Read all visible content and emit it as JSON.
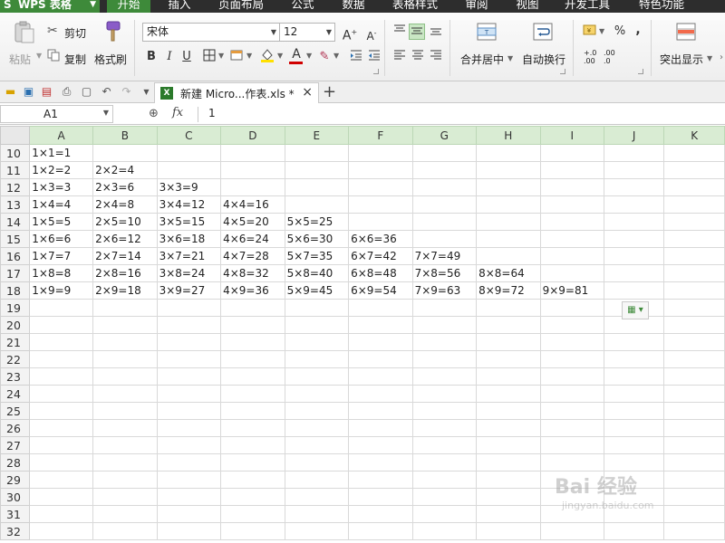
{
  "menubar": {
    "app_button": "WPS 表格",
    "tabs": [
      "开始",
      "插入",
      "页面布局",
      "公式",
      "数据",
      "表格样式",
      "审阅",
      "视图",
      "开发工具",
      "特色功能"
    ],
    "active_tab": "开始"
  },
  "ribbon": {
    "paste": "粘贴",
    "cut": "剪切",
    "copy": "复制",
    "format_painter": "格式刷",
    "font_name": "宋体",
    "font_size": "12",
    "merge_center": "合并居中",
    "wrap_text": "自动换行",
    "highlight": "突出显示",
    "percent": "%",
    "comma": ",",
    "inc_decimal": "+.0 .00",
    "dec_decimal": ".00 .0",
    "bold": "B",
    "italic": "I",
    "underline": "U",
    "font_color_label": "A",
    "grow_font": "A",
    "shrink_font": "A"
  },
  "doc_tab": {
    "icon_text": "X",
    "name": "新建 Micro...作表.xls *"
  },
  "formula_bar": {
    "name_box": "A1",
    "fx": "fx",
    "value": "1"
  },
  "columns": [
    "A",
    "B",
    "C",
    "D",
    "E",
    "F",
    "G",
    "H",
    "I",
    "J",
    "K"
  ],
  "rows": [
    {
      "num": "10",
      "cells": [
        "1×1=1",
        "",
        "",
        "",
        "",
        "",
        "",
        "",
        "",
        "",
        ""
      ]
    },
    {
      "num": "11",
      "cells": [
        "1×2=2",
        "2×2=4",
        "",
        "",
        "",
        "",
        "",
        "",
        "",
        "",
        ""
      ]
    },
    {
      "num": "12",
      "cells": [
        "1×3=3",
        "2×3=6",
        "3×3=9",
        "",
        "",
        "",
        "",
        "",
        "",
        "",
        ""
      ]
    },
    {
      "num": "13",
      "cells": [
        "1×4=4",
        "2×4=8",
        "3×4=12",
        "4×4=16",
        "",
        "",
        "",
        "",
        "",
        "",
        ""
      ]
    },
    {
      "num": "14",
      "cells": [
        "1×5=5",
        "2×5=10",
        "3×5=15",
        "4×5=20",
        "5×5=25",
        "",
        "",
        "",
        "",
        "",
        ""
      ]
    },
    {
      "num": "15",
      "cells": [
        "1×6=6",
        "2×6=12",
        "3×6=18",
        "4×6=24",
        "5×6=30",
        "6×6=36",
        "",
        "",
        "",
        "",
        ""
      ]
    },
    {
      "num": "16",
      "cells": [
        "1×7=7",
        "2×7=14",
        "3×7=21",
        "4×7=28",
        "5×7=35",
        "6×7=42",
        "7×7=49",
        "",
        "",
        "",
        ""
      ]
    },
    {
      "num": "17",
      "cells": [
        "1×8=8",
        "2×8=16",
        "3×8=24",
        "4×8=32",
        "5×8=40",
        "6×8=48",
        "7×8=56",
        "8×8=64",
        "",
        "",
        ""
      ]
    },
    {
      "num": "18",
      "cells": [
        "1×9=9",
        "2×9=18",
        "3×9=27",
        "4×9=36",
        "5×9=45",
        "6×9=54",
        "7×9=63",
        "8×9=72",
        "9×9=81",
        "",
        ""
      ]
    },
    {
      "num": "19",
      "cells": [
        "",
        "",
        "",
        "",
        "",
        "",
        "",
        "",
        "",
        "",
        ""
      ]
    },
    {
      "num": "20",
      "cells": [
        "",
        "",
        "",
        "",
        "",
        "",
        "",
        "",
        "",
        "",
        ""
      ]
    },
    {
      "num": "21",
      "cells": [
        "",
        "",
        "",
        "",
        "",
        "",
        "",
        "",
        "",
        "",
        ""
      ]
    },
    {
      "num": "22",
      "cells": [
        "",
        "",
        "",
        "",
        "",
        "",
        "",
        "",
        "",
        "",
        ""
      ]
    },
    {
      "num": "23",
      "cells": [
        "",
        "",
        "",
        "",
        "",
        "",
        "",
        "",
        "",
        "",
        ""
      ]
    },
    {
      "num": "24",
      "cells": [
        "",
        "",
        "",
        "",
        "",
        "",
        "",
        "",
        "",
        "",
        ""
      ]
    },
    {
      "num": "25",
      "cells": [
        "",
        "",
        "",
        "",
        "",
        "",
        "",
        "",
        "",
        "",
        ""
      ]
    },
    {
      "num": "26",
      "cells": [
        "",
        "",
        "",
        "",
        "",
        "",
        "",
        "",
        "",
        "",
        ""
      ]
    },
    {
      "num": "27",
      "cells": [
        "",
        "",
        "",
        "",
        "",
        "",
        "",
        "",
        "",
        "",
        ""
      ]
    },
    {
      "num": "28",
      "cells": [
        "",
        "",
        "",
        "",
        "",
        "",
        "",
        "",
        "",
        "",
        ""
      ]
    },
    {
      "num": "29",
      "cells": [
        "",
        "",
        "",
        "",
        "",
        "",
        "",
        "",
        "",
        "",
        ""
      ]
    },
    {
      "num": "30",
      "cells": [
        "",
        "",
        "",
        "",
        "",
        "",
        "",
        "",
        "",
        "",
        ""
      ]
    },
    {
      "num": "31",
      "cells": [
        "",
        "",
        "",
        "",
        "",
        "",
        "",
        "",
        "",
        "",
        ""
      ]
    },
    {
      "num": "32",
      "cells": [
        "",
        "",
        "",
        "",
        "",
        "",
        "",
        "",
        "",
        "",
        ""
      ]
    }
  ],
  "watermark": {
    "title": "Bai 经验",
    "url": "jingyan.baidu.com"
  },
  "colors": {
    "accent": "#3e8a3a",
    "menubar_bg": "#2d2d2d",
    "column_header_bg": "#d9ecd3"
  }
}
